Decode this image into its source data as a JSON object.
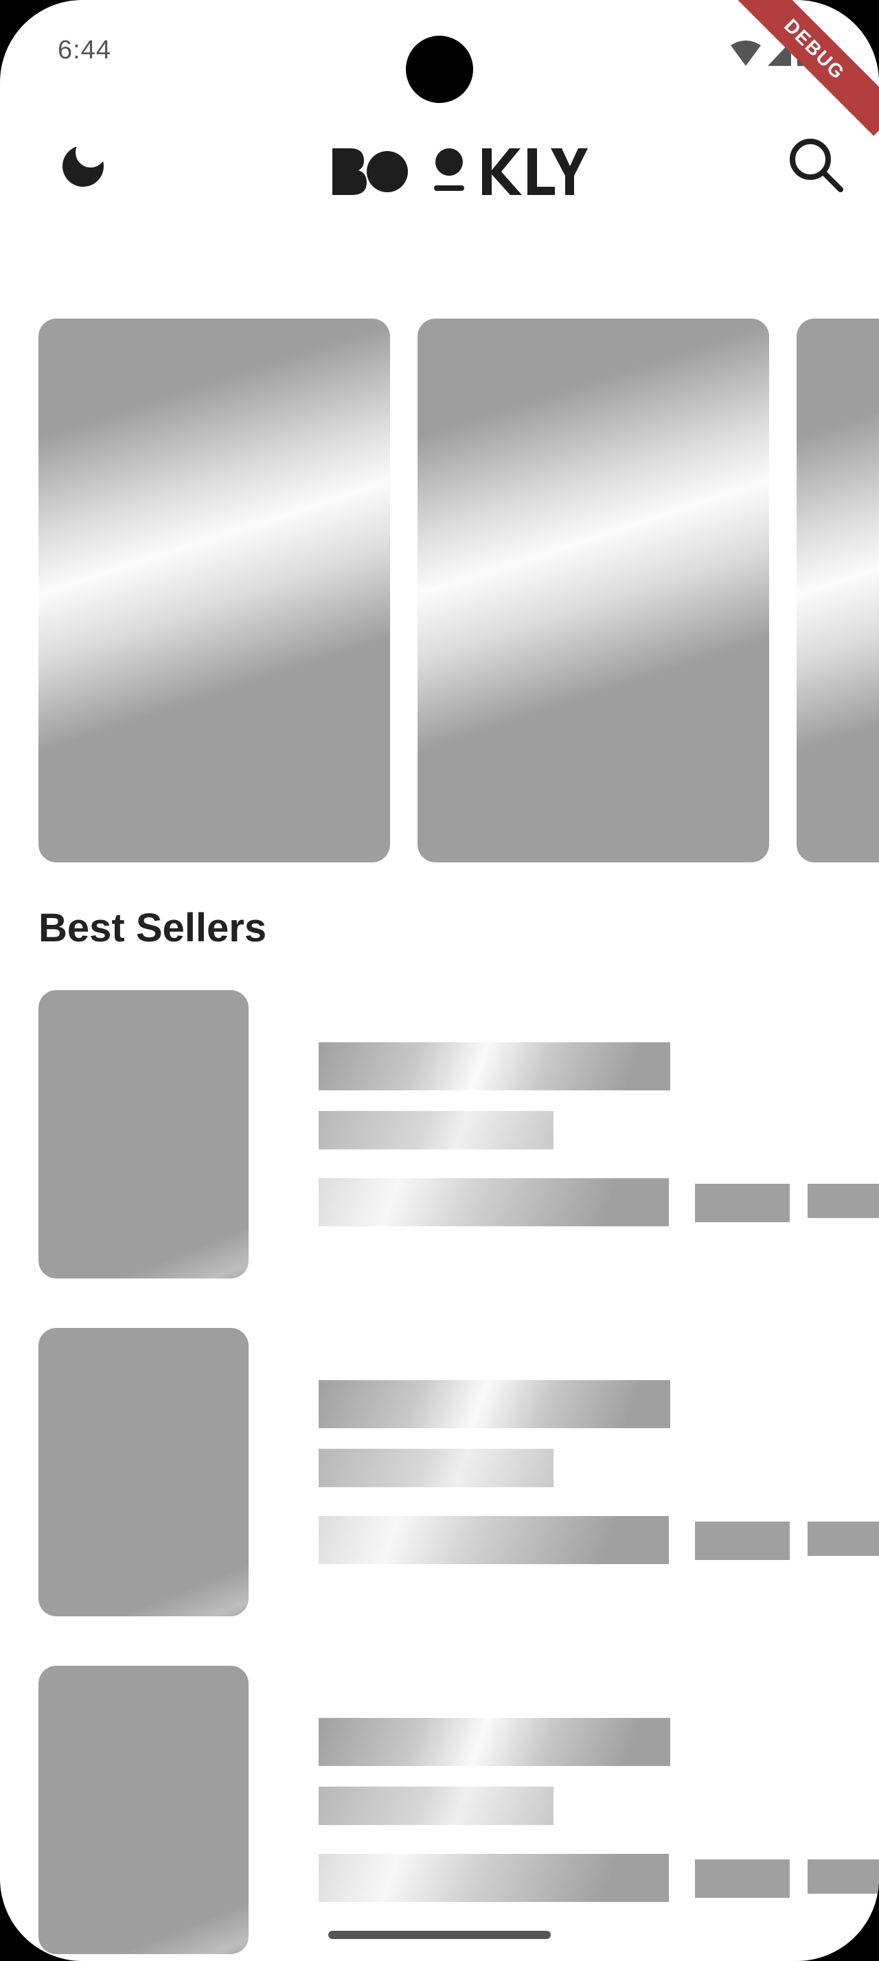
{
  "status_bar": {
    "time": "6:44",
    "icons": [
      "wifi-icon",
      "signal-icon",
      "battery-icon"
    ],
    "debug_label": "DEBUG"
  },
  "app_bar": {
    "logo_text": "BOOKLY",
    "leading_icon": "moon-icon",
    "trailing_icon": "search-icon"
  },
  "featured_books": {
    "visible_cards": 3,
    "state": "loading"
  },
  "best_sellers": {
    "title": "Best Sellers",
    "visible_rows": 3,
    "state": "loading"
  },
  "colors": {
    "background": "#ffffff",
    "skeleton_base": "#9e9e9e",
    "skeleton_highlight": "#fafafa",
    "text_primary": "#222222",
    "debug_ribbon": "#b23e3f"
  }
}
